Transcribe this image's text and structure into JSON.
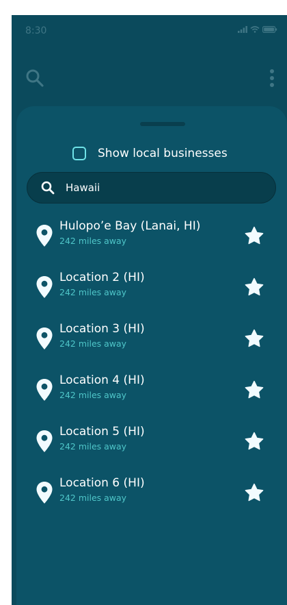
{
  "status_bar": {
    "time": "8:30"
  },
  "filter": {
    "show_local_label": "Show local businesses",
    "show_local_checked": false
  },
  "search": {
    "value": "Hawaii"
  },
  "results": [
    {
      "title": "Hulopo’e Bay (Lanai, HI)",
      "distance": "242 miles away"
    },
    {
      "title": "Location 2 (HI)",
      "distance": "242 miles away"
    },
    {
      "title": "Location 3 (HI)",
      "distance": "242 miles away"
    },
    {
      "title": "Location 4 (HI)",
      "distance": "242 miles away"
    },
    {
      "title": "Location 5 (HI)",
      "distance": "242 miles away"
    },
    {
      "title": "Location 6 (HI)",
      "distance": "242 miles away"
    }
  ],
  "colors": {
    "background": "#0b4a5c",
    "sheet": "#0c5367",
    "accent": "#6fe3e8",
    "subtext": "#4fc6c9",
    "text": "#ffffff"
  },
  "icons": {
    "top_search": "search-icon",
    "more": "more-vertical-icon",
    "field_search": "search-icon",
    "result_pin": "map-pin-icon",
    "favorite": "star-icon"
  }
}
